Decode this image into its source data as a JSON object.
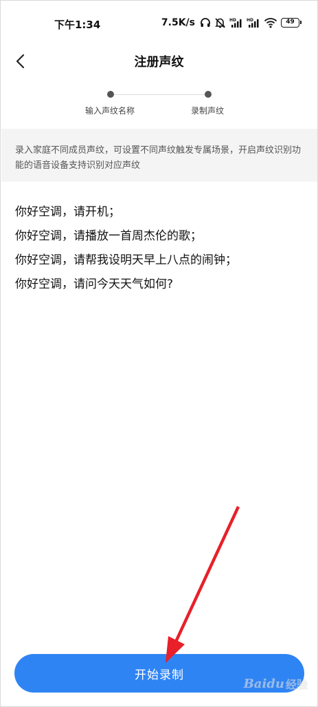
{
  "status_bar": {
    "time": "下午1:34",
    "network_speed": "7.5K/s",
    "battery_level": "49",
    "icons": [
      "headphones-icon",
      "mute-icon",
      "signal-hd-1-icon",
      "signal-hd-2-icon",
      "wifi-icon",
      "battery-icon"
    ]
  },
  "header": {
    "title": "注册声纹",
    "back_icon": "chevron-left-icon"
  },
  "steps": {
    "items": [
      {
        "label": "输入声纹名称"
      },
      {
        "label": "录制声纹"
      }
    ]
  },
  "info": {
    "text": "录入家庭不同成员声纹，可设置不同声纹触发专属场景，开启声纹识别功能的语音设备支持识别对应声纹"
  },
  "phrases": [
    "你好空调，请开机；",
    "你好空调，请播放一首周杰伦的歌；",
    "你好空调，请帮我设明天早上八点的闹钟；",
    "你好空调，请问今天天气如何?"
  ],
  "actions": {
    "start_label": "开始录制"
  },
  "watermark": {
    "brand": "Baidu",
    "sub": "经验"
  },
  "colors": {
    "primary": "#2f84f4",
    "annotation_arrow": "#e8202a",
    "info_bg": "#f4f4f4"
  }
}
